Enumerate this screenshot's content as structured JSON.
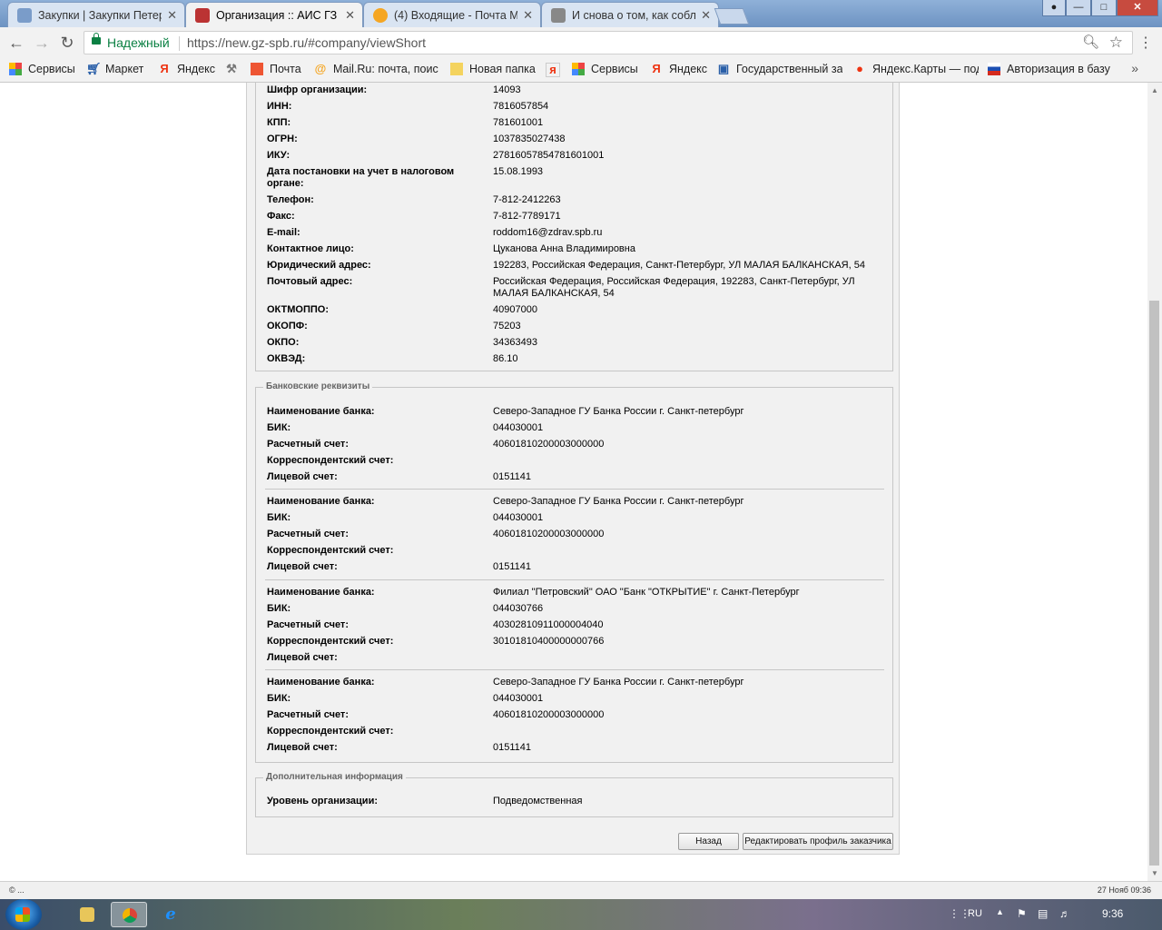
{
  "browser": {
    "tabs": [
      {
        "label": "Закупки | Закупки Петер",
        "close": "✕"
      },
      {
        "label": "Организация :: АИС ГЗ",
        "close": "✕"
      },
      {
        "label": "(4) Входящие - Почта М",
        "close": "✕"
      },
      {
        "label": "И снова о том, как собл",
        "close": "✕"
      }
    ],
    "secure_label": "Надежный",
    "url": "https://new.gz-spb.ru/#company/viewShort",
    "bookmarks": [
      {
        "label": "Сервисы",
        "icon": "apps-icon"
      },
      {
        "label": "Маркет",
        "icon": "cart-icon"
      },
      {
        "label": "Яндекс",
        "icon": "yandex-icon"
      },
      {
        "label": "",
        "icon": "tools-icon"
      },
      {
        "label": "Почта",
        "icon": "mail-icon"
      },
      {
        "label": "Mail.Ru: почта, поис",
        "icon": "mailru-icon"
      },
      {
        "label": "Новая папка",
        "icon": "folder-icon"
      },
      {
        "label": "",
        "icon": "yandex-box-icon"
      },
      {
        "label": "Сервисы",
        "icon": "apps-icon"
      },
      {
        "label": "Яндекс",
        "icon": "yandex-icon"
      },
      {
        "label": "Государственный за",
        "icon": "gov-icon"
      },
      {
        "label": "Яндекс.Карты — под",
        "icon": "map-pin-icon"
      },
      {
        "label": "Авторизация в базу",
        "icon": "flag-icon"
      }
    ],
    "bookmarks_more": "»"
  },
  "org": {
    "fields": [
      {
        "label": "Шифр организации:",
        "value": "14093"
      },
      {
        "label": "ИНН:",
        "value": "7816057854"
      },
      {
        "label": "КПП:",
        "value": "781601001"
      },
      {
        "label": "ОГРН:",
        "value": "1037835027438"
      },
      {
        "label": "ИКУ:",
        "value": "27816057854781601001"
      },
      {
        "label": "Дата постановки на учет в налоговом органе:",
        "value": "15.08.1993"
      },
      {
        "label": "Телефон:",
        "value": "7-812-2412263"
      },
      {
        "label": "Факс:",
        "value": "7-812-7789171"
      },
      {
        "label": "E-mail:",
        "value": "roddom16@zdrav.spb.ru"
      },
      {
        "label": "Контактное лицо:",
        "value": "Цуканова Анна Владимировна"
      },
      {
        "label": "Юридический адрес:",
        "value": "192283, Российская Федерация, Санкт-Петербург, УЛ МАЛАЯ БАЛКАНСКАЯ, 54"
      },
      {
        "label": "Почтовый адрес:",
        "value": "Российская Федерация, Российская Федерация, 192283, Санкт-Петербург, УЛ МАЛАЯ БАЛКАНСКАЯ, 54"
      },
      {
        "label": "ОКТМОППО:",
        "value": "40907000"
      },
      {
        "label": "ОКОПФ:",
        "value": "75203"
      },
      {
        "label": "ОКПО:",
        "value": "34363493"
      },
      {
        "label": "ОКВЭД:",
        "value": "86.10"
      }
    ]
  },
  "bank": {
    "legend": "Банковские реквизиты",
    "labels": {
      "name": "Наименование банка:",
      "bik": "БИК:",
      "account": "Расчетный счет:",
      "corr": "Корреспондентский счет:",
      "personal": "Лицевой счет:"
    },
    "accounts": [
      {
        "name": "Северо-Западное ГУ Банка России г. Санкт-петербург",
        "bik": "044030001",
        "account": "40601810200003000000",
        "corr": "",
        "personal": "0151141"
      },
      {
        "name": "Северо-Западное ГУ Банка России г. Санкт-петербург",
        "bik": "044030001",
        "account": "40601810200003000000",
        "corr": "",
        "personal": "0151141"
      },
      {
        "name": "Филиал \"Петровский\" ОАО \"Банк \"ОТКРЫТИЕ\" г. Санкт-Петербург",
        "bik": "044030766",
        "account": "40302810911000004040",
        "corr": "30101810400000000766",
        "personal": ""
      },
      {
        "name": "Северо-Западное ГУ Банка России г. Санкт-петербург",
        "bik": "044030001",
        "account": "40601810200003000000",
        "corr": "",
        "personal": "0151141"
      }
    ]
  },
  "extra": {
    "legend": "Дополнительная информация",
    "level_label": "Уровень организации:",
    "level_value": "Подведомственная"
  },
  "buttons": {
    "back": "Назад",
    "edit": "Редактировать профиль заказчика"
  },
  "statusbar": {
    "left": "© ...",
    "right": "27 Нояб 09:36"
  },
  "taskbar": {
    "lang": "RU",
    "time": "9:36"
  }
}
